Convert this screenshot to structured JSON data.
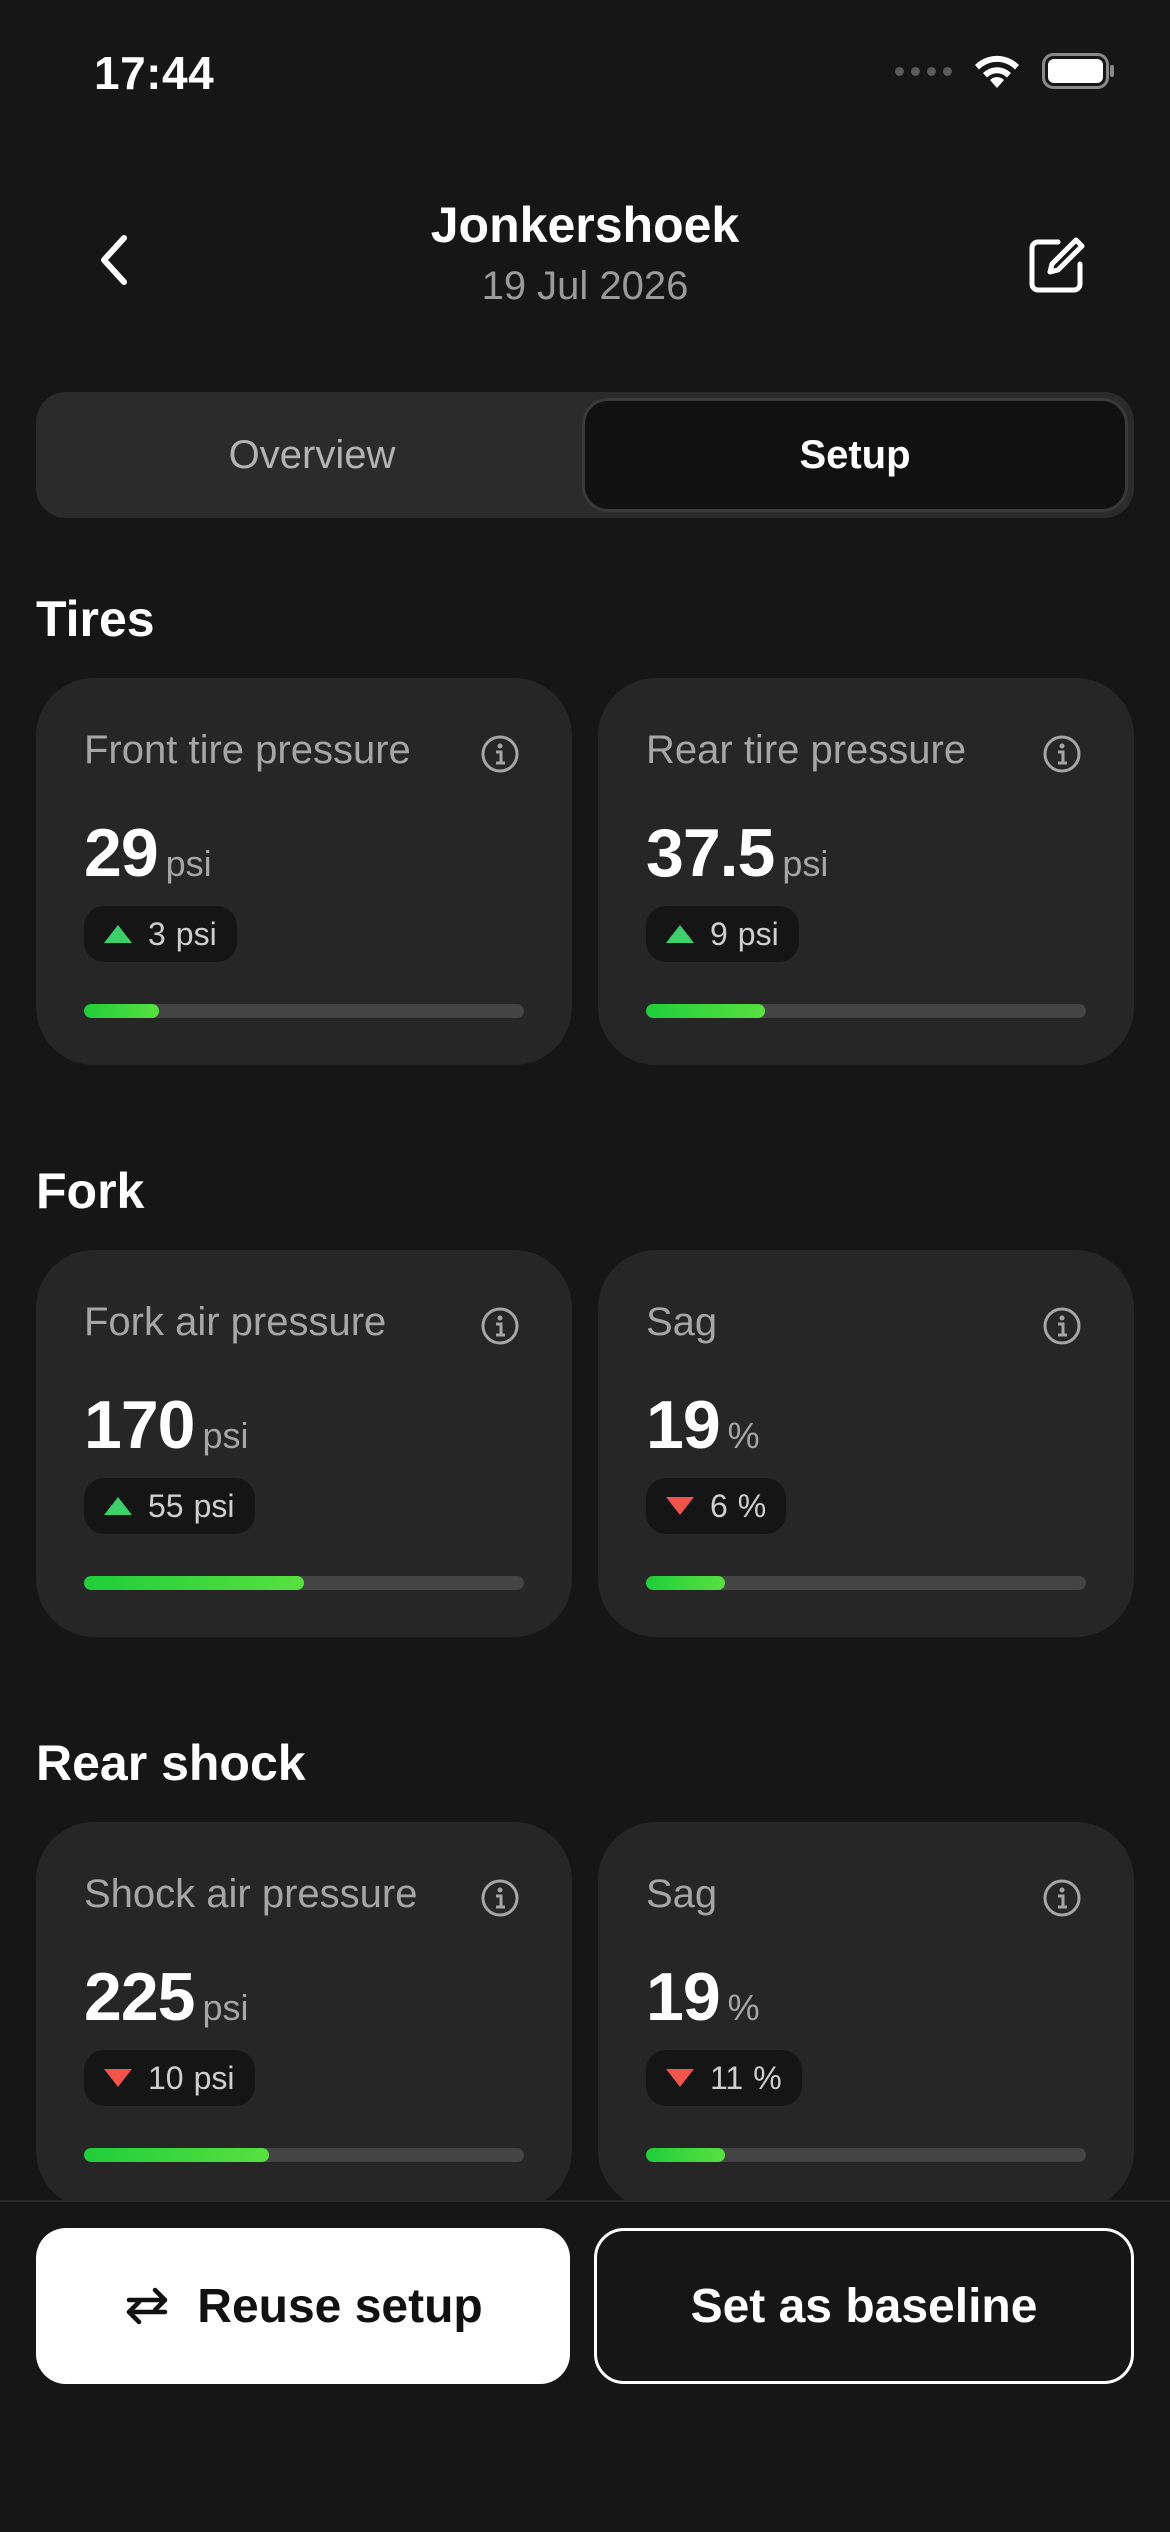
{
  "status_bar": {
    "time": "17:44"
  },
  "header": {
    "title": "Jonkershoek",
    "date": "19 Jul 2026"
  },
  "tabs": [
    {
      "label": "Overview",
      "active": false
    },
    {
      "label": "Setup",
      "active": true
    }
  ],
  "sections": [
    {
      "title": "Tires",
      "cards": [
        {
          "label": "Front tire pressure",
          "value": "29",
          "unit": "psi",
          "delta": "3",
          "delta_unit": "psi",
          "direction": "up",
          "fill": 0.17
        },
        {
          "label": "Rear tire pressure",
          "value": "37.5",
          "unit": "psi",
          "delta": "9",
          "delta_unit": "psi",
          "direction": "up",
          "fill": 0.27
        }
      ]
    },
    {
      "title": "Fork",
      "cards": [
        {
          "label": "Fork air pressure",
          "value": "170",
          "unit": "psi",
          "delta": "55",
          "delta_unit": "psi",
          "direction": "up",
          "fill": 0.5
        },
        {
          "label": "Sag",
          "value": "19",
          "unit": "%",
          "delta": "6",
          "delta_unit": "%",
          "direction": "down",
          "fill": 0.18
        }
      ]
    },
    {
      "title": "Rear shock",
      "cards": [
        {
          "label": "Shock air pressure",
          "value": "225",
          "unit": "psi",
          "delta": "10",
          "delta_unit": "psi",
          "direction": "down",
          "fill": 0.42
        },
        {
          "label": "Sag",
          "value": "19",
          "unit": "%",
          "delta": "11",
          "delta_unit": "%",
          "direction": "down",
          "fill": 0.18
        }
      ]
    }
  ],
  "actions": {
    "reuse_label": "Reuse setup",
    "baseline_label": "Set as baseline"
  },
  "colors": {
    "up": "#3ccf6a",
    "down": "#f0544b",
    "accent_fill": "#1fce3a",
    "background": "#161616",
    "card": "#262626"
  },
  "icons": {
    "back": "chevron-left-icon",
    "edit": "edit-icon",
    "info": "info-icon",
    "reuse": "repeat-icon"
  }
}
